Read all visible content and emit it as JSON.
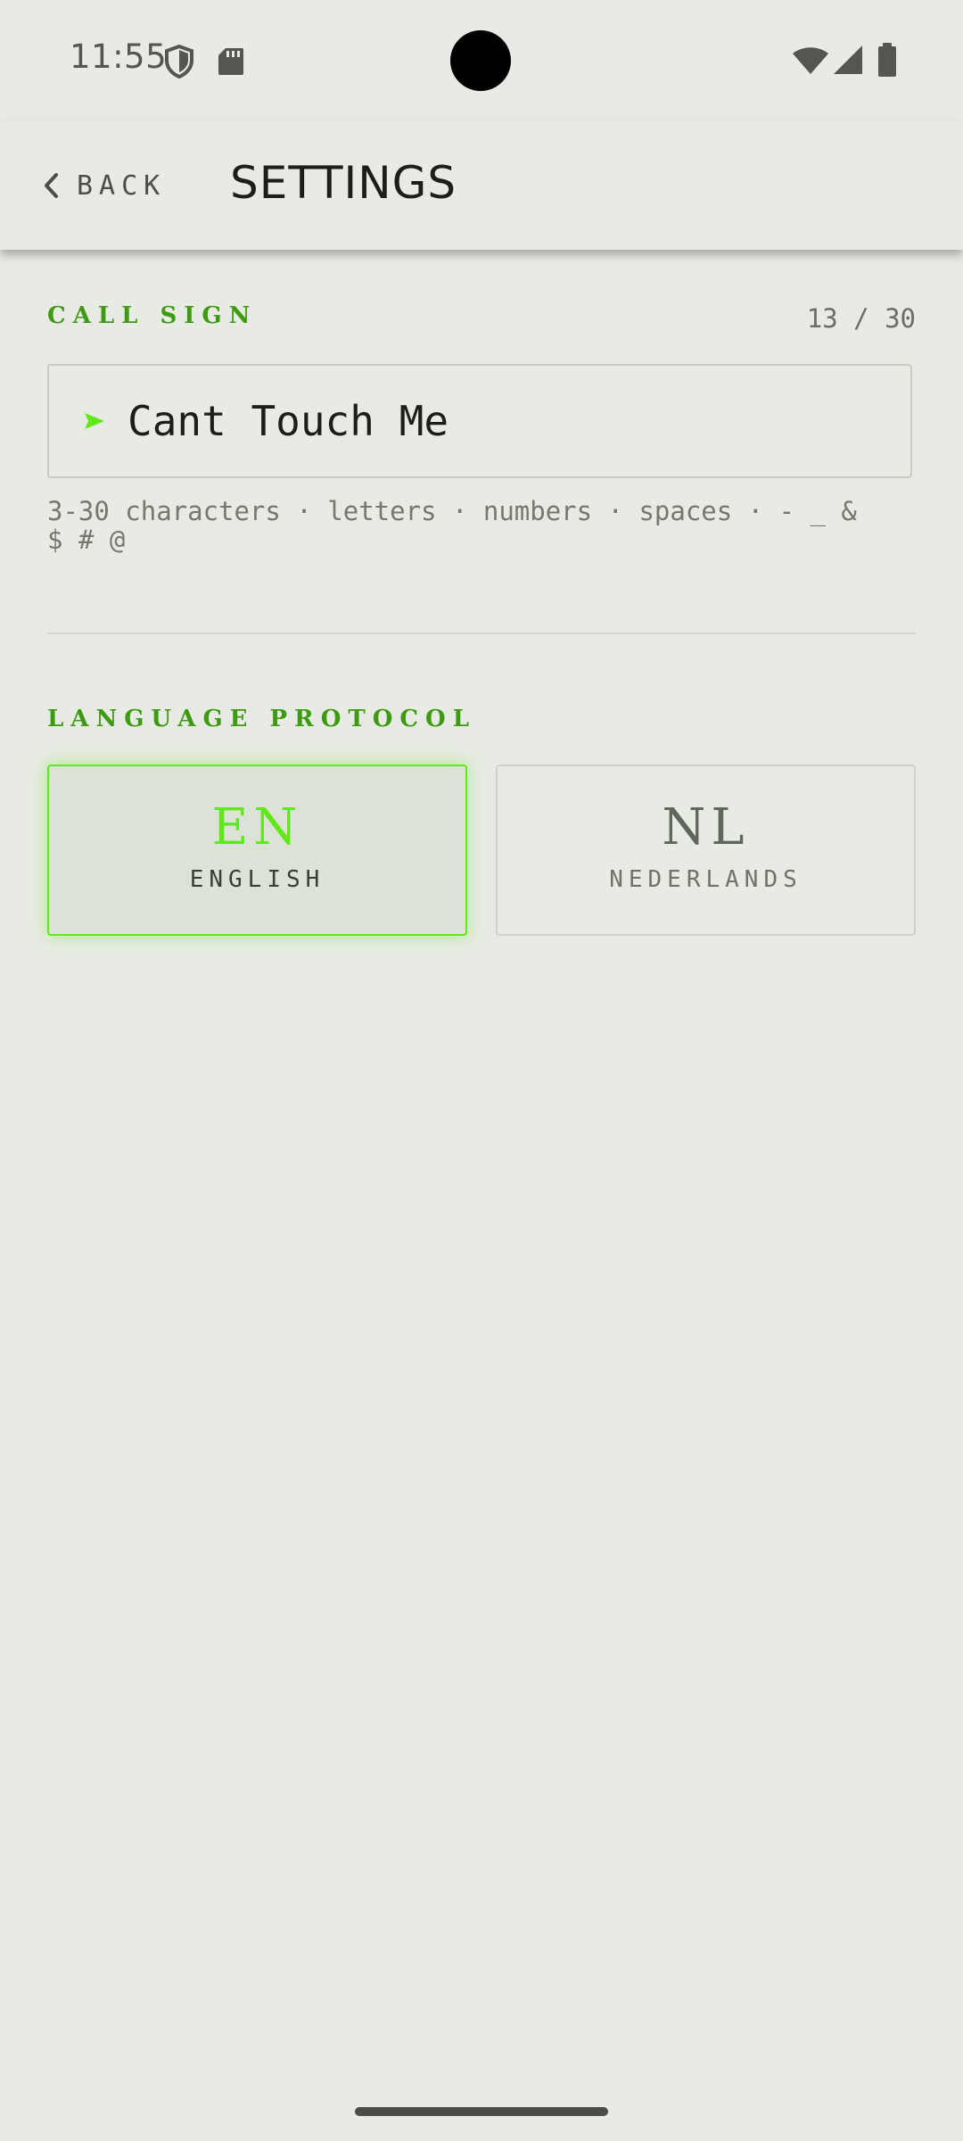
{
  "status_bar": {
    "time": "11:55"
  },
  "app_bar": {
    "back_label": "BACK",
    "title": "SETTINGS"
  },
  "call_sign": {
    "label": "CALL SIGN",
    "counter": "13 / 30",
    "value": "Cant Touch Me",
    "helper": "3-30 characters · letters · numbers · spaces · - _ &\n$ # @"
  },
  "language": {
    "label": "LANGUAGE PROTOCOL",
    "options": [
      {
        "code": "EN",
        "name": "ENGLISH",
        "selected": true
      },
      {
        "code": "NL",
        "name": "NEDERLANDS",
        "selected": false
      }
    ]
  },
  "colors": {
    "background": "#e8ebe3",
    "accent": "#5fe81a",
    "label_green": "#3e9a12"
  }
}
